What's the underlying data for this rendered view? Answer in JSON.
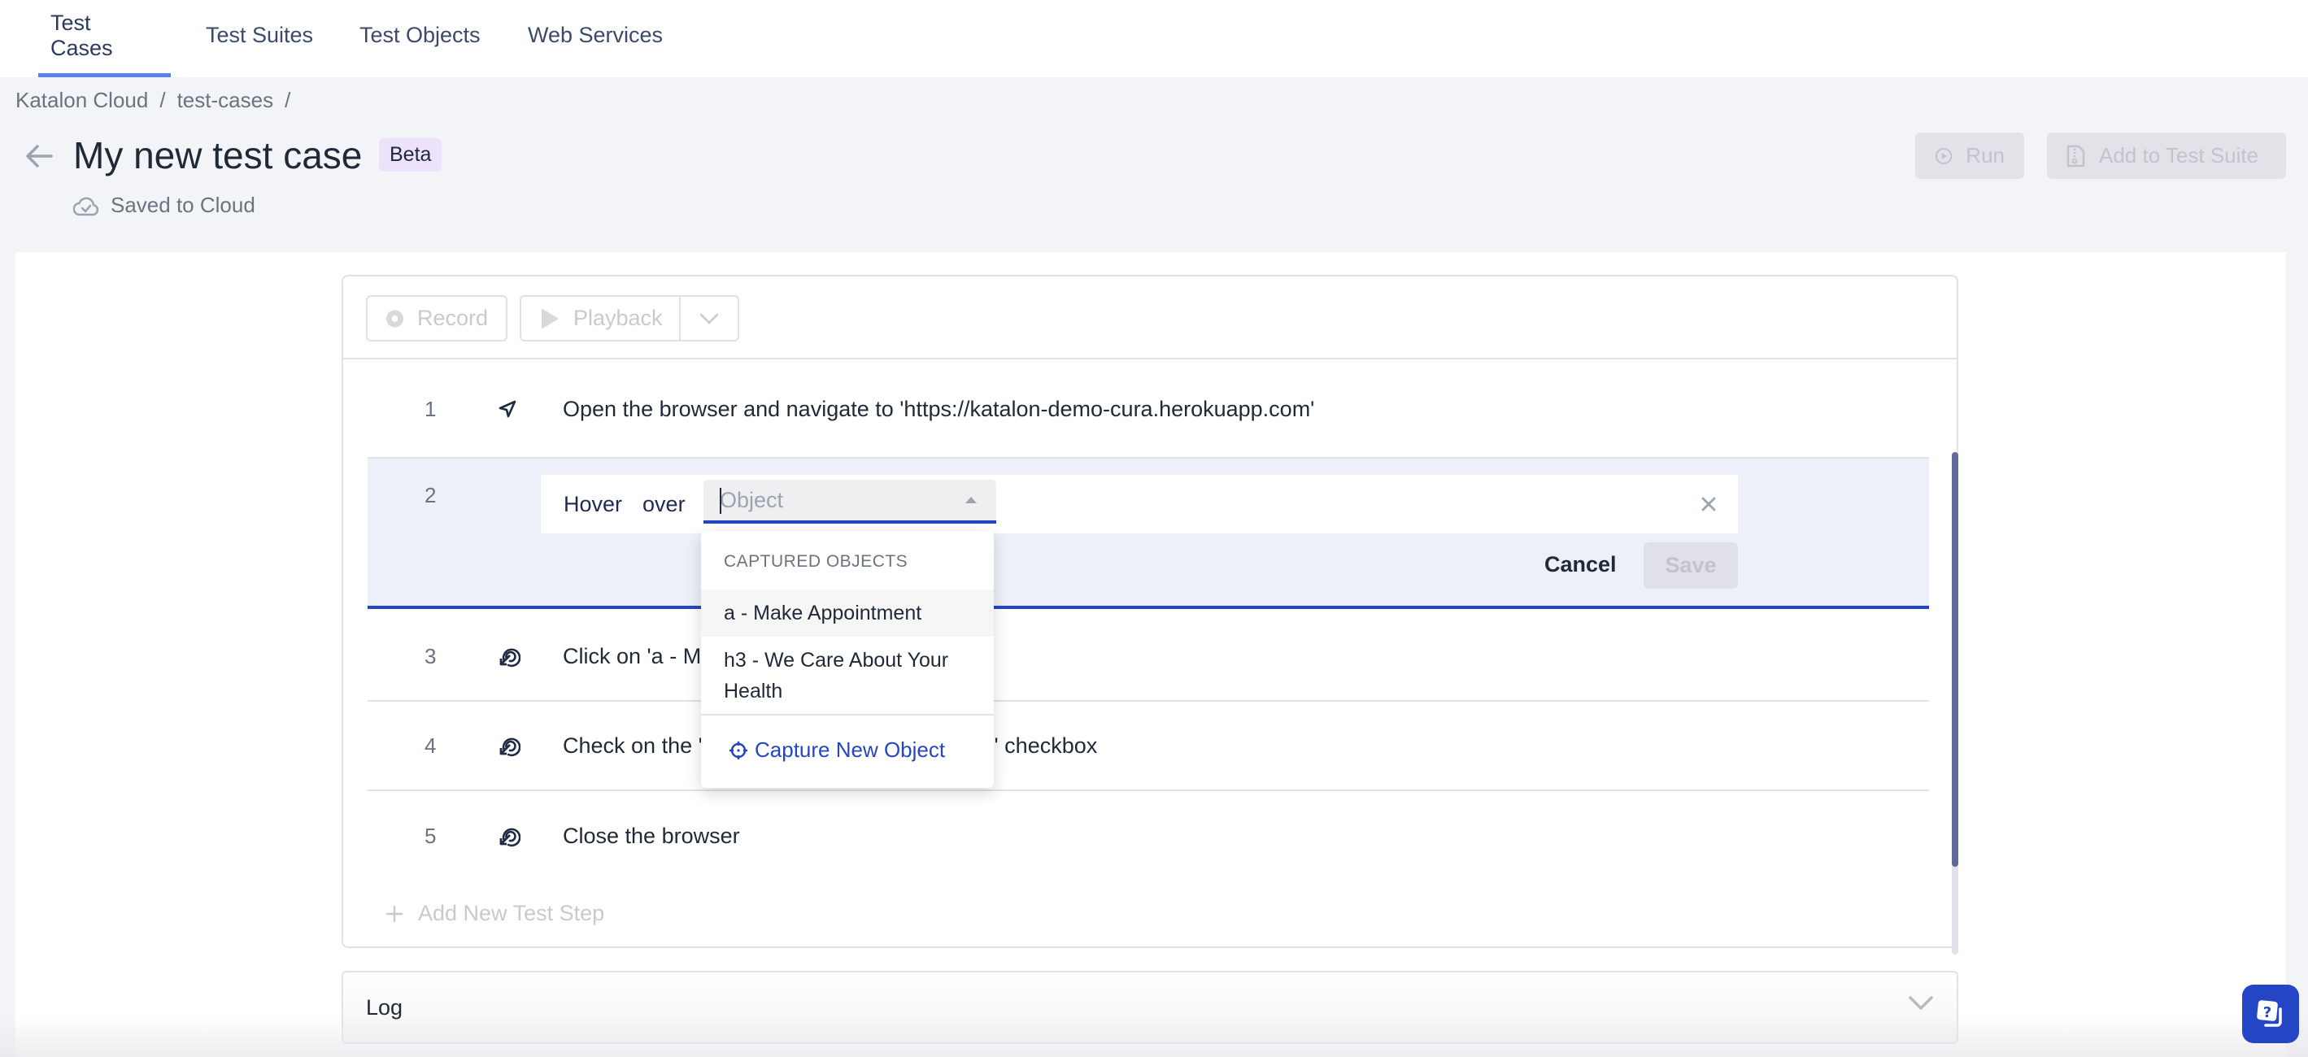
{
  "nav": {
    "tabs": [
      {
        "label": "Test Cases",
        "active": true
      },
      {
        "label": "Test Suites",
        "active": false
      },
      {
        "label": "Test Objects",
        "active": false
      },
      {
        "label": "Web Services",
        "active": false
      }
    ]
  },
  "breadcrumb": {
    "items": [
      "Katalon Cloud",
      "test-cases"
    ],
    "separator": "/"
  },
  "header": {
    "title": "My new test case",
    "badge": "Beta",
    "save_status": "Saved to Cloud",
    "run_label": "Run",
    "add_to_suite_label": "Add to Test Suite"
  },
  "toolbar": {
    "record_label": "Record",
    "playback_label": "Playback"
  },
  "steps": [
    {
      "num": "1",
      "icon": "navigate-arrow-icon",
      "text": "Open the browser and navigate to 'https://katalon-demo-cura.herokuapp.com'"
    },
    {
      "num": "2",
      "editing": true,
      "action": "Hover",
      "preposition": "over",
      "object_value": "",
      "object_placeholder": "Object"
    },
    {
      "num": "3",
      "icon": "click-target-icon",
      "text": "Click on 'a - M"
    },
    {
      "num": "4",
      "icon": "click-target-icon",
      "text": "Check on the '",
      "text_tail": "th' checkbox"
    },
    {
      "num": "5",
      "icon": "click-target-icon",
      "text": "Close the browser"
    }
  ],
  "edit": {
    "cancel_label": "Cancel",
    "save_label": "Save"
  },
  "dropdown": {
    "header": "CAPTURED OBJECTS",
    "items": [
      "a - Make Appointment",
      "h3 - We Care About Your Health"
    ],
    "capture_label": "Capture New Object"
  },
  "add_step_label": "Add New Test Step",
  "log": {
    "label": "Log"
  },
  "colors": {
    "accent": "#2546c4",
    "tab_underline": "#5b7ff2",
    "badge_bg": "#ede2fb",
    "scroll_thumb": "#5f6b96"
  }
}
